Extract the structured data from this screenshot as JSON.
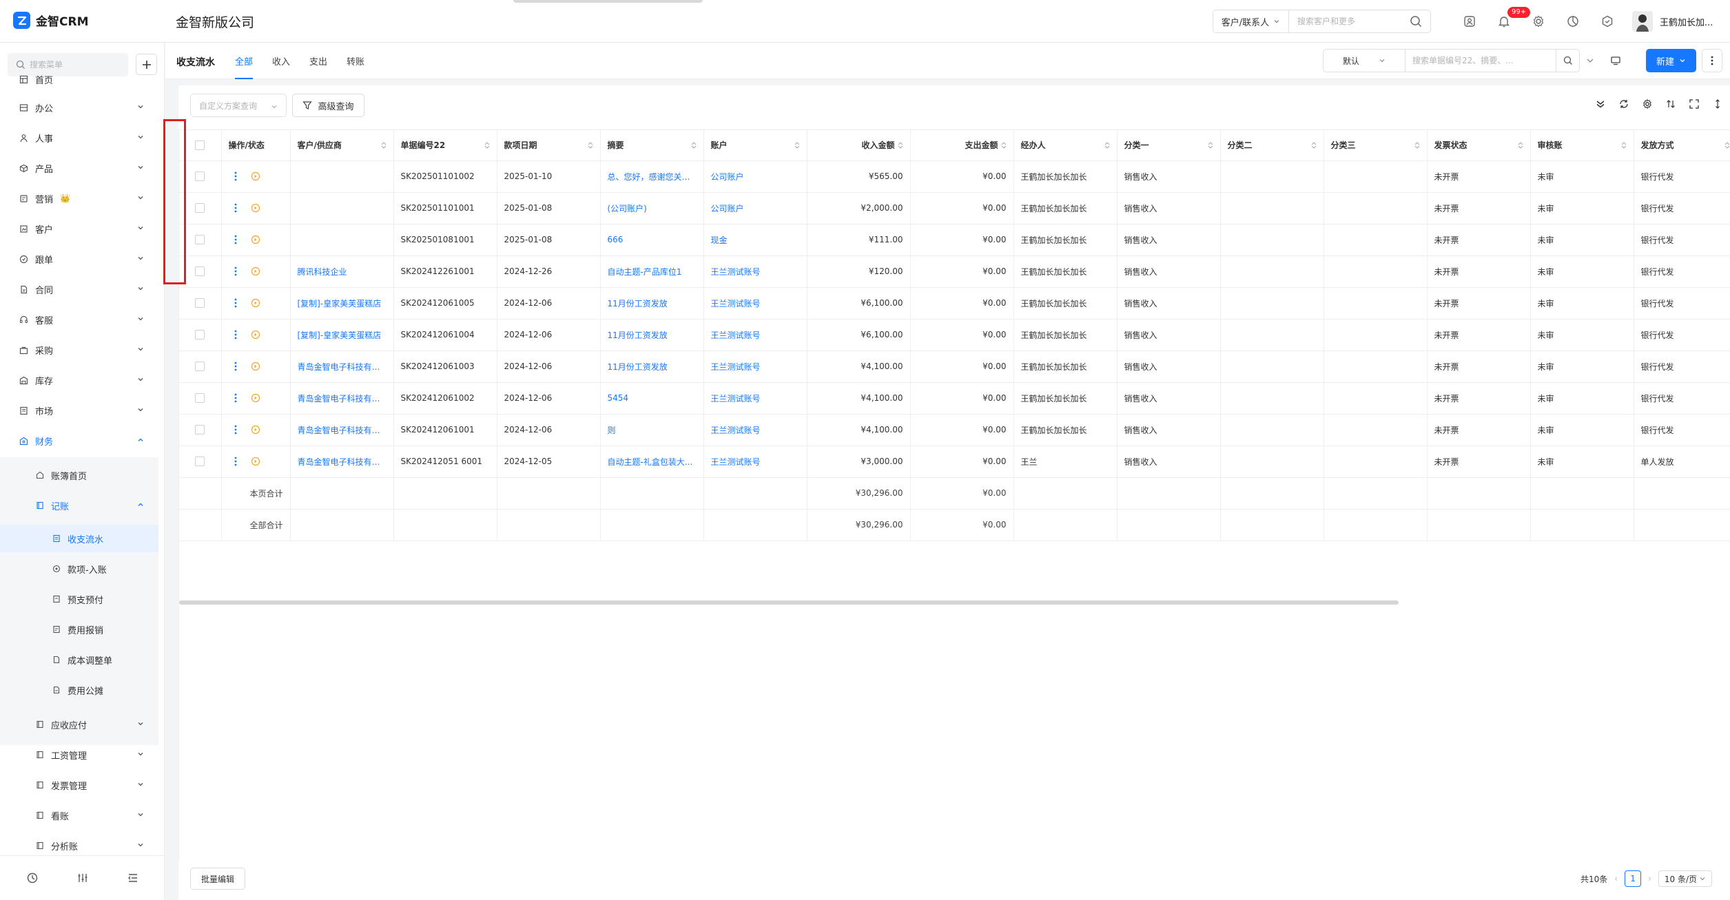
{
  "header": {
    "logo_text": "金智CRM",
    "company": "金智新版公司",
    "search_scope": "客户/联系人",
    "search_placeholder": "搜索客户和更多",
    "notification_count": "99+",
    "username": "王鹤加长加..."
  },
  "sidebar": {
    "search_placeholder": "搜索菜单",
    "items": [
      {
        "label": "首页",
        "icon": "home-icon"
      },
      {
        "label": "办公",
        "icon": "office-icon"
      },
      {
        "label": "人事",
        "icon": "people-icon"
      },
      {
        "label": "产品",
        "icon": "box-icon"
      },
      {
        "label": "营销",
        "icon": "marketing-icon",
        "extra": "👑"
      },
      {
        "label": "客户",
        "icon": "customer-icon"
      },
      {
        "label": "跟单",
        "icon": "follow-icon"
      },
      {
        "label": "合同",
        "icon": "contract-icon"
      },
      {
        "label": "客服",
        "icon": "service-icon"
      },
      {
        "label": "采购",
        "icon": "purchase-icon"
      },
      {
        "label": "库存",
        "icon": "inventory-icon"
      },
      {
        "label": "市场",
        "icon": "market-icon"
      },
      {
        "label": "财务",
        "icon": "finance-icon"
      }
    ],
    "finance_children": [
      {
        "label": "账簿首页"
      },
      {
        "label": "记账"
      }
    ],
    "bookkeeping_children": [
      {
        "label": "收支流水"
      },
      {
        "label": "款项-入账"
      },
      {
        "label": "预支预付"
      },
      {
        "label": "费用报销"
      },
      {
        "label": "成本调整单"
      },
      {
        "label": "费用公摊"
      }
    ],
    "finance_more": [
      {
        "label": "应收应付"
      },
      {
        "label": "工资管理"
      },
      {
        "label": "发票管理"
      },
      {
        "label": "看账"
      },
      {
        "label": "分析账"
      }
    ]
  },
  "page": {
    "title": "收支流水",
    "tabs": [
      "全部",
      "收入",
      "支出",
      "转账"
    ],
    "view_name": "默认",
    "view_search_placeholder": "搜索单据编号22、摘要、...",
    "new_label": "新建",
    "filter_placeholder": "自定义方案查询",
    "advanced_label": "高级查询"
  },
  "table": {
    "columns": [
      "操作/状态",
      "客户/供应商",
      "单据编号22",
      "款项日期",
      "摘要",
      "账户",
      "收入金额",
      "支出金额",
      "经办人",
      "分类一",
      "分类二",
      "分类三",
      "发票状态",
      "审核账",
      "发放方式"
    ],
    "rows": [
      [
        "",
        "SK202501101002",
        "2025-01-10",
        "总、您好，感谢您关注...",
        "公司账户",
        "¥565.00",
        "¥0.00",
        "王鹤加长加长加长",
        "销售收入",
        "",
        "",
        "未开票",
        "未审",
        "银行代发"
      ],
      [
        "",
        "SK202501101001",
        "2025-01-08",
        "(公司账户)",
        "公司账户",
        "¥2,000.00",
        "¥0.00",
        "王鹤加长加长加长",
        "销售收入",
        "",
        "",
        "未开票",
        "未审",
        "银行代发"
      ],
      [
        "",
        "SK202501081001",
        "2025-01-08",
        "666",
        "现金",
        "¥111.00",
        "¥0.00",
        "王鹤加长加长加长",
        "销售收入",
        "",
        "",
        "未开票",
        "未审",
        "银行代发"
      ],
      [
        "腾讯科技企业",
        "SK202412261001",
        "2024-12-26",
        "自动主题-产品库位1",
        "王兰测试账号",
        "¥120.00",
        "¥0.00",
        "王鹤加长加长加长",
        "销售收入",
        "",
        "",
        "未开票",
        "未审",
        "银行代发"
      ],
      [
        "[复制]-皇家美芙蛋糕店",
        "SK202412061005",
        "2024-12-06",
        "11月份工资发放",
        "王兰测试账号",
        "¥6,100.00",
        "¥0.00",
        "王鹤加长加长加长",
        "销售收入",
        "",
        "",
        "未开票",
        "未审",
        "银行代发"
      ],
      [
        "[复制]-皇家美芙蛋糕店",
        "SK202412061004",
        "2024-12-06",
        "11月份工资发放",
        "王兰测试账号",
        "¥6,100.00",
        "¥0.00",
        "王鹤加长加长加长",
        "销售收入",
        "",
        "",
        "未开票",
        "未审",
        "银行代发"
      ],
      [
        "青岛金智电子科技有限...",
        "SK202412061003",
        "2024-12-06",
        "11月份工资发放",
        "王兰测试账号",
        "¥4,100.00",
        "¥0.00",
        "王鹤加长加长加长",
        "销售收入",
        "",
        "",
        "未开票",
        "未审",
        "银行代发"
      ],
      [
        "青岛金智电子科技有限...",
        "SK202412061002",
        "2024-12-06",
        "5454",
        "王兰测试账号",
        "¥4,100.00",
        "¥0.00",
        "王鹤加长加长加长",
        "销售收入",
        "",
        "",
        "未开票",
        "未审",
        "银行代发"
      ],
      [
        "青岛金智电子科技有限...",
        "SK202412061001",
        "2024-12-06",
        "则",
        "王兰测试账号",
        "¥4,100.00",
        "¥0.00",
        "王鹤加长加长加长",
        "销售收入",
        "",
        "",
        "未开票",
        "未审",
        "银行代发"
      ],
      [
        "青岛金智电子科技有限...",
        "SK202412051 6001",
        "2024-12-05",
        "自动主题-礼盒包装大...",
        "王兰测试账号",
        "¥3,000.00",
        "¥0.00",
        "王兰",
        "销售收入",
        "",
        "",
        "未开票",
        "未审",
        "单人发放"
      ]
    ],
    "footer": [
      {
        "label": "本页合计",
        "income": "¥30,296.00",
        "expense": "¥0.00"
      },
      {
        "label": "全部合计",
        "income": "¥30,296.00",
        "expense": "¥0.00"
      }
    ]
  },
  "bottom": {
    "batch_label": "批量编辑",
    "total": "共10条",
    "current_page": "1",
    "page_size": "10 条/页"
  },
  "colors": {
    "accent": "#1677ff",
    "status_circle": "#f5a623",
    "highlight": "#e02020"
  }
}
